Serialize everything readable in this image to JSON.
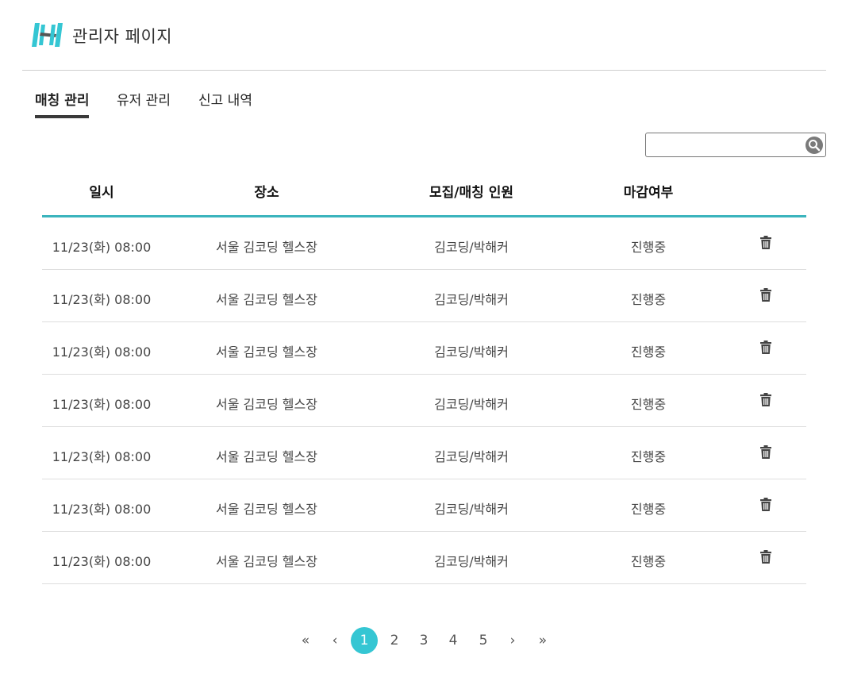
{
  "header": {
    "title": "관리자 페이지",
    "logo_color": "#35c6d3"
  },
  "tabs": [
    {
      "label": "매칭 관리",
      "active": true
    },
    {
      "label": "유저 관리",
      "active": false
    },
    {
      "label": "신고 내역",
      "active": false
    }
  ],
  "search": {
    "placeholder": "",
    "value": "",
    "icon": "search-icon"
  },
  "table": {
    "columns": [
      "일시",
      "장소",
      "모집/매칭 인원",
      "마감여부"
    ],
    "accent_color": "#3bb4bd",
    "rows": [
      {
        "date": "11/23(화) 08:00",
        "place": "서울 김코딩 헬스장",
        "members": "김코딩/박해커",
        "status": "진행중",
        "action_icon": "trash-icon"
      },
      {
        "date": "11/23(화) 08:00",
        "place": "서울 김코딩 헬스장",
        "members": "김코딩/박해커",
        "status": "진행중",
        "action_icon": "trash-icon"
      },
      {
        "date": "11/23(화) 08:00",
        "place": "서울 김코딩 헬스장",
        "members": "김코딩/박해커",
        "status": "진행중",
        "action_icon": "trash-icon"
      },
      {
        "date": "11/23(화) 08:00",
        "place": "서울 김코딩 헬스장",
        "members": "김코딩/박해커",
        "status": "진행중",
        "action_icon": "trash-icon"
      },
      {
        "date": "11/23(화) 08:00",
        "place": "서울 김코딩 헬스장",
        "members": "김코딩/박해커",
        "status": "진행중",
        "action_icon": "trash-icon"
      },
      {
        "date": "11/23(화) 08:00",
        "place": "서울 김코딩 헬스장",
        "members": "김코딩/박해커",
        "status": "진행중",
        "action_icon": "trash-icon"
      },
      {
        "date": "11/23(화) 08:00",
        "place": "서울 김코딩 헬스장",
        "members": "김코딩/박해커",
        "status": "진행중",
        "action_icon": "trash-icon"
      }
    ]
  },
  "pagination": {
    "first": "«",
    "prev": "‹",
    "pages": [
      "1",
      "2",
      "3",
      "4",
      "5"
    ],
    "current": "1",
    "next": "›",
    "last": "»",
    "active_color": "#35c6d3"
  }
}
